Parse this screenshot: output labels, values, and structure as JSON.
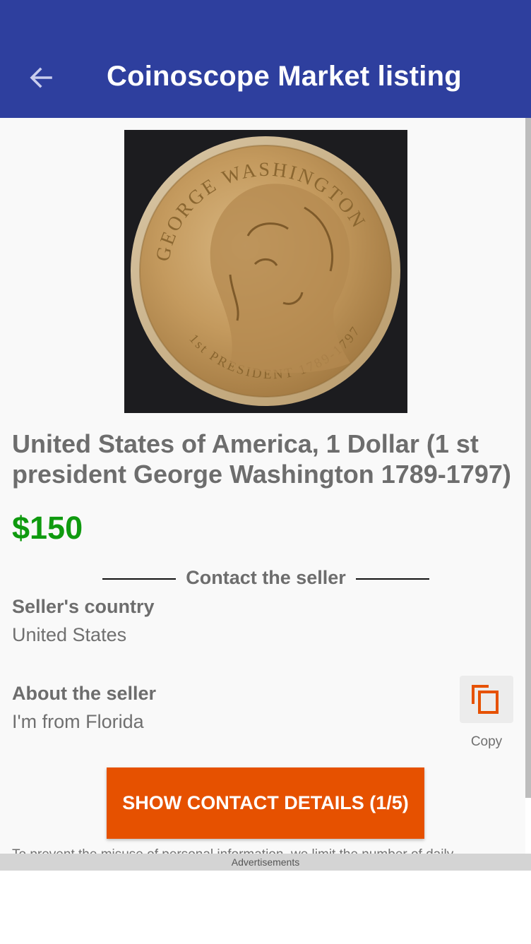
{
  "appbar": {
    "title": "Coinoscope Market listing",
    "back_icon": "arrow-left-icon",
    "color": "#2e3f9e"
  },
  "listing": {
    "image": {
      "legend_top": "GEORGE WASHINGTON",
      "legend_bottom": "1st PRESIDENT 1789-1797"
    },
    "title": "United States of America, 1 Dollar (1 st president George Washington 1789-1797)",
    "price": "$150",
    "price_color": "#0f9a0f"
  },
  "contact": {
    "section_title": "Contact the seller",
    "country_label": "Seller's country",
    "country_value": "United States",
    "about_label": "About the seller",
    "about_value": "I'm from Florida",
    "copy_icon": "copy-icon",
    "copy_label": "Copy",
    "show_button_label": "SHOW CONTACT DETAILS (1/5)",
    "button_color": "#e65100",
    "notice_text": "To prevent the misuse of personal information, we limit the number of daily"
  },
  "ads": {
    "label": "Advertisements"
  }
}
